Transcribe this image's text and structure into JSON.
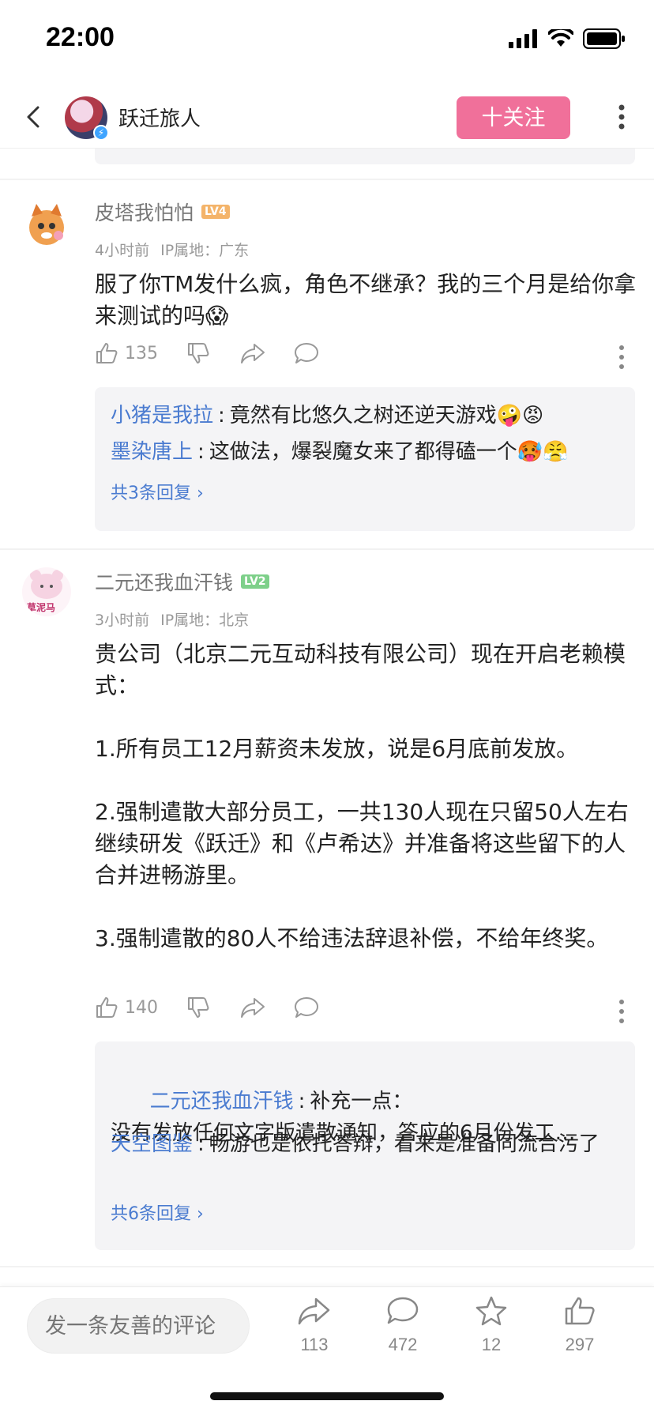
{
  "status_bar": {
    "time": "22:00"
  },
  "header": {
    "username": "跃迁旅人",
    "follow_label": "十关注"
  },
  "comments": [
    {
      "username": "皮塔我怕怕",
      "level": "LV4",
      "level_color": "#f4b46a",
      "time": "4小时前",
      "ip": "IP属地：广东",
      "text": "服了你TM发什么疯，角色不继承？我的三个月是给你拿来测试的吗😱",
      "likes": "135",
      "replies": [
        {
          "user": "小猪是我拉",
          "text": "竟然有比悠久之树还逆天游戏🤪😡"
        },
        {
          "user": "墨染唐上",
          "text": "这做法，爆裂魔女来了都得磕一个🥵😤"
        }
      ],
      "more_replies": "共3条回复 ›"
    },
    {
      "username": "二元还我血汗钱",
      "level": "LV2",
      "level_color": "#7ed08a",
      "time": "3小时前",
      "ip": "IP属地：北京",
      "text": "贵公司（北京二元互动科技有限公司）现在开启老赖模式：\n\n1.所有员工12月薪资未发放，说是6月底前发放。\n\n2.强制遣散大部分员工，一共130人现在只留50人左右继续研发《跃迁》和《卢希达》并准备将这些留下的人合并进畅游里。\n\n3.强制遣散的80人不给违法辞退补偿，不给年终奖。",
      "likes": "140",
      "replies": [
        {
          "user": "二元还我血汗钱",
          "text": "补充一点：\n没有发放任何文字版遣散通知，答应的6月份发工…"
        },
        {
          "user": "天空图鉴",
          "text": "畅游也是依托答辩，看来是准备同流合污了"
        }
      ],
      "more_replies": "共6条回复 ›"
    }
  ],
  "bottom_bar": {
    "input_placeholder": "发一条友善的评论",
    "share_count": "113",
    "comment_count": "472",
    "favorite_count": "12",
    "like_count": "297"
  },
  "avatar_texts": {
    "c2": "草泥马"
  }
}
